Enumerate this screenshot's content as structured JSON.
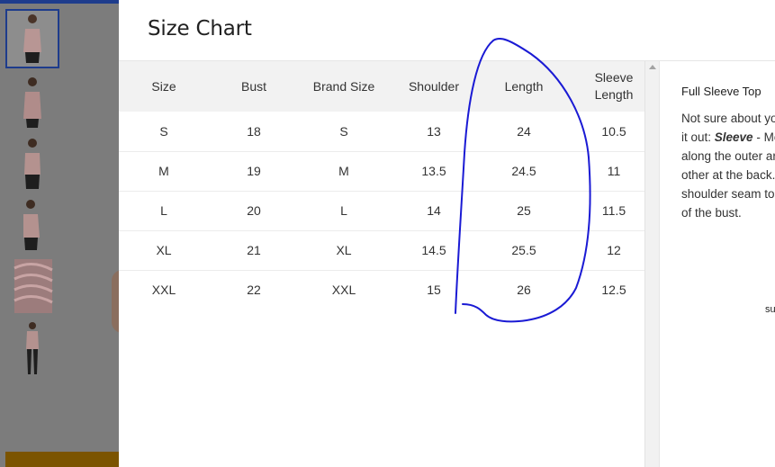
{
  "modal": {
    "title": "Size Chart"
  },
  "table": {
    "headers": [
      "Size",
      "Bust",
      "Brand Size",
      "Shoulder",
      "Length",
      "Sleeve Length"
    ],
    "rows": [
      [
        "S",
        "18",
        "S",
        "13",
        "24",
        "10.5"
      ],
      [
        "M",
        "19",
        "M",
        "13.5",
        "24.5",
        "11"
      ],
      [
        "L",
        "20",
        "L",
        "14",
        "25",
        "11.5"
      ],
      [
        "XL",
        "21",
        "XL",
        "14.5",
        "25.5",
        "12"
      ],
      [
        "XXL",
        "22",
        "XXL",
        "15",
        "26",
        "12.5"
      ]
    ]
  },
  "side_panel": {
    "heading": "Full Sleeve Top",
    "lines": [
      "Not sure about yo",
      "it out: ",
      "along the outer ar",
      "other at the back.",
      "shoulder seam to",
      "of the bust."
    ],
    "emphasis": "Sleeve",
    "after_emphasis": " - Me",
    "diagram_label": "su"
  },
  "thumbnails": [
    "product-front",
    "product-back",
    "product-side",
    "product-angle",
    "fabric-closeup",
    "product-full"
  ],
  "colors": {
    "overlay": "#7c7c7c",
    "accent": "#1e3c8c",
    "annotation": "#1a1ad4",
    "header_bg": "#f2f2f2"
  }
}
